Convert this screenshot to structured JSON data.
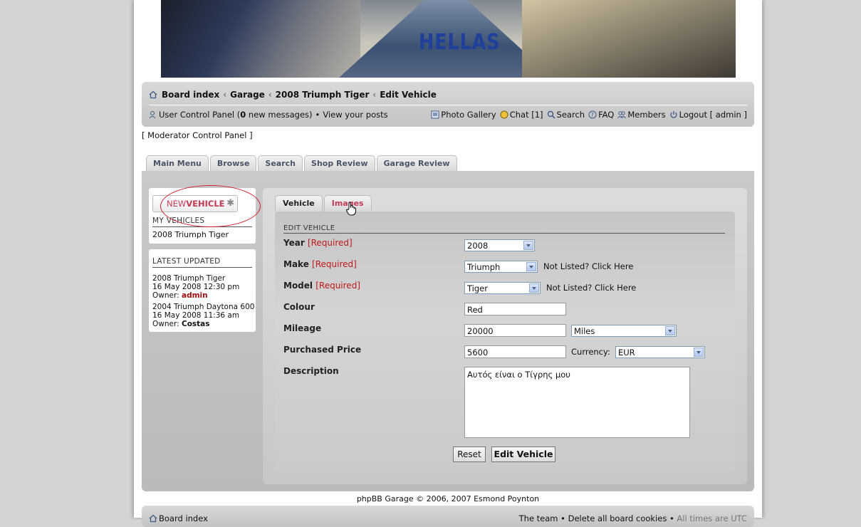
{
  "header": {
    "logo_text": "HELLAS"
  },
  "breadcrumb": [
    "Board index",
    "Garage",
    "2008 Triumph Tiger",
    "Edit Vehicle"
  ],
  "usernav": {
    "ucp_prefix": "User Control Panel (",
    "ucp_count": "0",
    "ucp_suffix": " new messages)",
    "bullet": "•",
    "view_posts": "View your posts",
    "photo_gallery": "Photo Gallery",
    "chat": "Chat [1]",
    "search": "Search",
    "faq": "FAQ",
    "members": "Members",
    "logout": "Logout [ admin ]"
  },
  "moderator_link": "[ Moderator Control Panel ]",
  "garage_tabs": [
    "Main Menu",
    "Browse",
    "Search",
    "Shop Review",
    "Garage Review"
  ],
  "sidebar": {
    "new_vehicle_prefix": "NEW",
    "new_vehicle_word": "VEHICLE",
    "my_vehicles_title": "MY VEHICLES",
    "my_vehicle": "2008 Triumph Tiger",
    "latest_title": "LATEST UPDATED",
    "latest": [
      {
        "vehicle": "2008 Triumph Tiger",
        "date": "16 May 2008 12:30 pm",
        "owner_label": "Owner: ",
        "owner": "admin"
      },
      {
        "vehicle": "2004 Triumph Daytona 600",
        "date": "16 May 2008 11:36 am",
        "owner_label": "Owner: ",
        "owner": "Costas"
      }
    ]
  },
  "form_tabs": {
    "vehicle": "Vehicle",
    "images": "Images"
  },
  "form": {
    "legend": "EDIT VEHICLE",
    "required": "[Required]",
    "year_label": "Year",
    "year_value": "2008",
    "make_label": "Make",
    "make_value": "Triumph",
    "not_listed": "Not Listed? Click Here",
    "model_label": "Model",
    "model_value": "Tiger",
    "colour_label": "Colour",
    "colour_value": "Red",
    "mileage_label": "Mileage",
    "mileage_value": "20000",
    "mileage_unit": "Miles",
    "price_label": "Purchased Price",
    "price_value": "5600",
    "currency_label": "Currency:",
    "currency_value": "EUR",
    "description_label": "Description",
    "description_value": "Αυτός είναι ο Τίγρης μου",
    "reset": "Reset",
    "submit": "Edit Vehicle"
  },
  "footer": {
    "credit": "phpBB Garage © 2006, 2007 Esmond Poynton",
    "board_index": "Board index",
    "right_links": "The team • Delete all board cookies •",
    "timezone": "All times are UTC"
  }
}
